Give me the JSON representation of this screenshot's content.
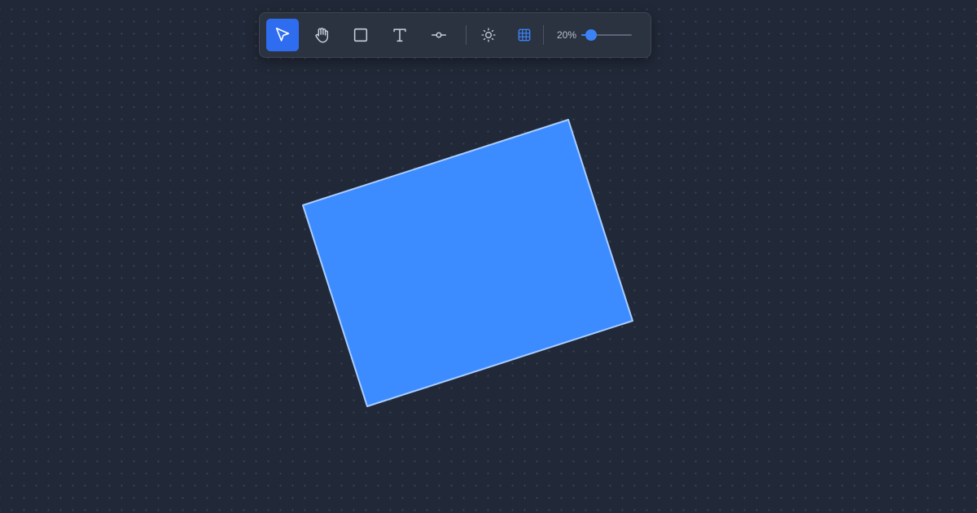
{
  "toolbar": {
    "tools": [
      {
        "name": "select",
        "icon": "cursor-arrow-icon",
        "active": true
      },
      {
        "name": "pan",
        "icon": "hand-icon",
        "active": false
      },
      {
        "name": "rectangle",
        "icon": "square-icon",
        "active": false
      },
      {
        "name": "text",
        "icon": "text-t-icon",
        "active": false
      },
      {
        "name": "connector",
        "icon": "line-node-icon",
        "active": false
      }
    ],
    "theme_icon": "sun-icon",
    "grid_icon": "grid-icon",
    "zoom": {
      "label": "20%",
      "value_percent": 20
    }
  },
  "canvas": {
    "shape": {
      "type": "rectangle",
      "fill": "#3d8cff",
      "stroke": "#a9cdff"
    }
  },
  "colors": {
    "background": "#212837",
    "accent": "#2f6df0",
    "slider": "#3b82f6"
  }
}
